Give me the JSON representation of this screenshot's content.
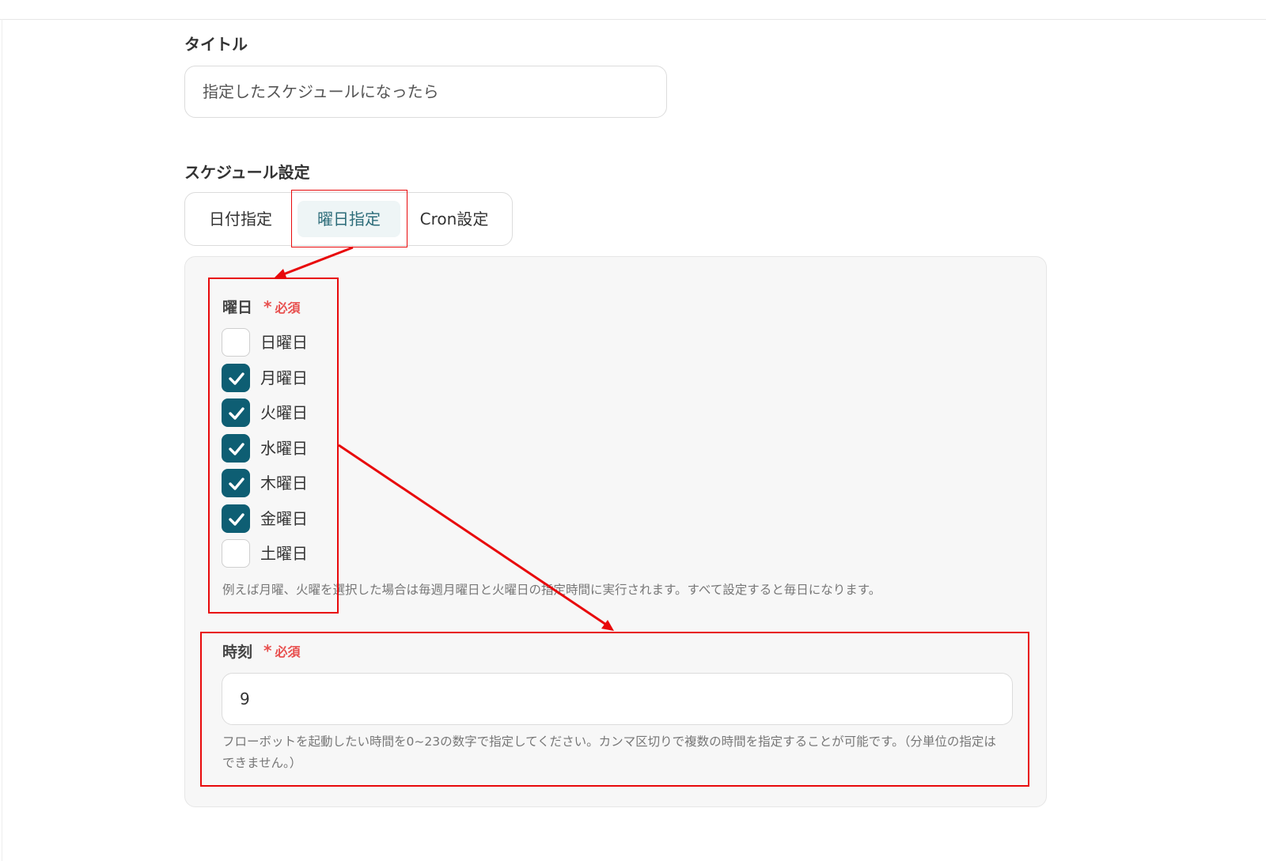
{
  "title_section": {
    "label": "タイトル",
    "value": "指定したスケジュールになったら"
  },
  "schedule_section": {
    "label": "スケジュール設定",
    "tabs": [
      {
        "label": "日付指定",
        "active": false
      },
      {
        "label": "曜日指定",
        "active": true
      },
      {
        "label": "Cron設定",
        "active": false
      }
    ]
  },
  "weekday_field": {
    "label": "曜日",
    "required_star": "*",
    "required_text": "必須",
    "options": [
      {
        "label": "日曜日",
        "checked": false
      },
      {
        "label": "月曜日",
        "checked": true
      },
      {
        "label": "火曜日",
        "checked": true
      },
      {
        "label": "水曜日",
        "checked": true
      },
      {
        "label": "木曜日",
        "checked": true
      },
      {
        "label": "金曜日",
        "checked": true
      },
      {
        "label": "土曜日",
        "checked": false
      }
    ],
    "help": "例えば月曜、火曜を選択した場合は毎週月曜日と火曜日の指定時間に実行されます。すべて設定すると毎日になります。"
  },
  "hour_field": {
    "label": "時刻",
    "required_star": "*",
    "required_text": "必須",
    "value": "9",
    "help": "フローボットを起動したい時間を0~23の数字で指定してください。カンマ区切りで複数の時間を指定することが可能です。（分単位の指定はできません。）"
  },
  "colors": {
    "checkbox_checked": "#0e5e73",
    "active_tab_bg": "#eef5f6",
    "active_tab_text": "#2c6c79",
    "required": "#e8504f",
    "annotation": "#e8090b"
  }
}
